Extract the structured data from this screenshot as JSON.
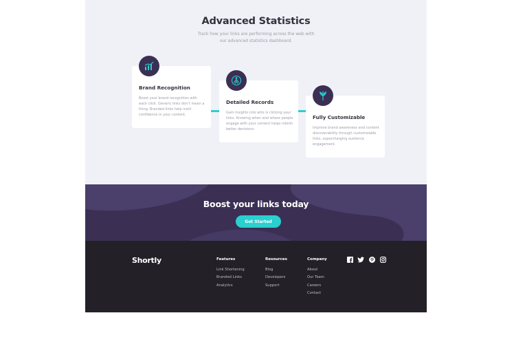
{
  "stats": {
    "title": "Advanced Statistics",
    "subtitle": "Track how your links are performing across the web with our advanced statistics dashboard.",
    "cards": [
      {
        "icon": "brand-recognition-icon",
        "title": "Brand Recognition",
        "text": "Boost your brand recognition with each click. Generic links don’t mean a thing. Branded links help instil confidence in your content."
      },
      {
        "icon": "detailed-records-icon",
        "title": "Detailed Records",
        "text": "Gain insights into who is clicking your links. Knowing when and where people engage with your content helps inform better decisions."
      },
      {
        "icon": "fully-customizable-icon",
        "title": "Fully Customizable",
        "text": "Improve brand awareness and content discoverability through customizable links, supercharging audience engagement."
      }
    ]
  },
  "boost": {
    "title": "Boost your links today",
    "button": "Get Started"
  },
  "footer": {
    "logo": "Shortly",
    "columns": [
      {
        "heading": "Features",
        "links": [
          "Link Shortening",
          "Branded Links",
          "Analytics"
        ]
      },
      {
        "heading": "Resources",
        "links": [
          "Blog",
          "Developers",
          "Support"
        ]
      },
      {
        "heading": "Company",
        "links": [
          "About",
          "Our Team",
          "Careers",
          "Contact"
        ]
      }
    ],
    "socials": [
      "facebook-icon",
      "twitter-icon",
      "pinterest-icon",
      "instagram-icon"
    ]
  },
  "colors": {
    "accent": "#2acfcf",
    "dark_violet": "#3b3054",
    "very_dark": "#232127",
    "light_bg": "#eff1f7"
  }
}
